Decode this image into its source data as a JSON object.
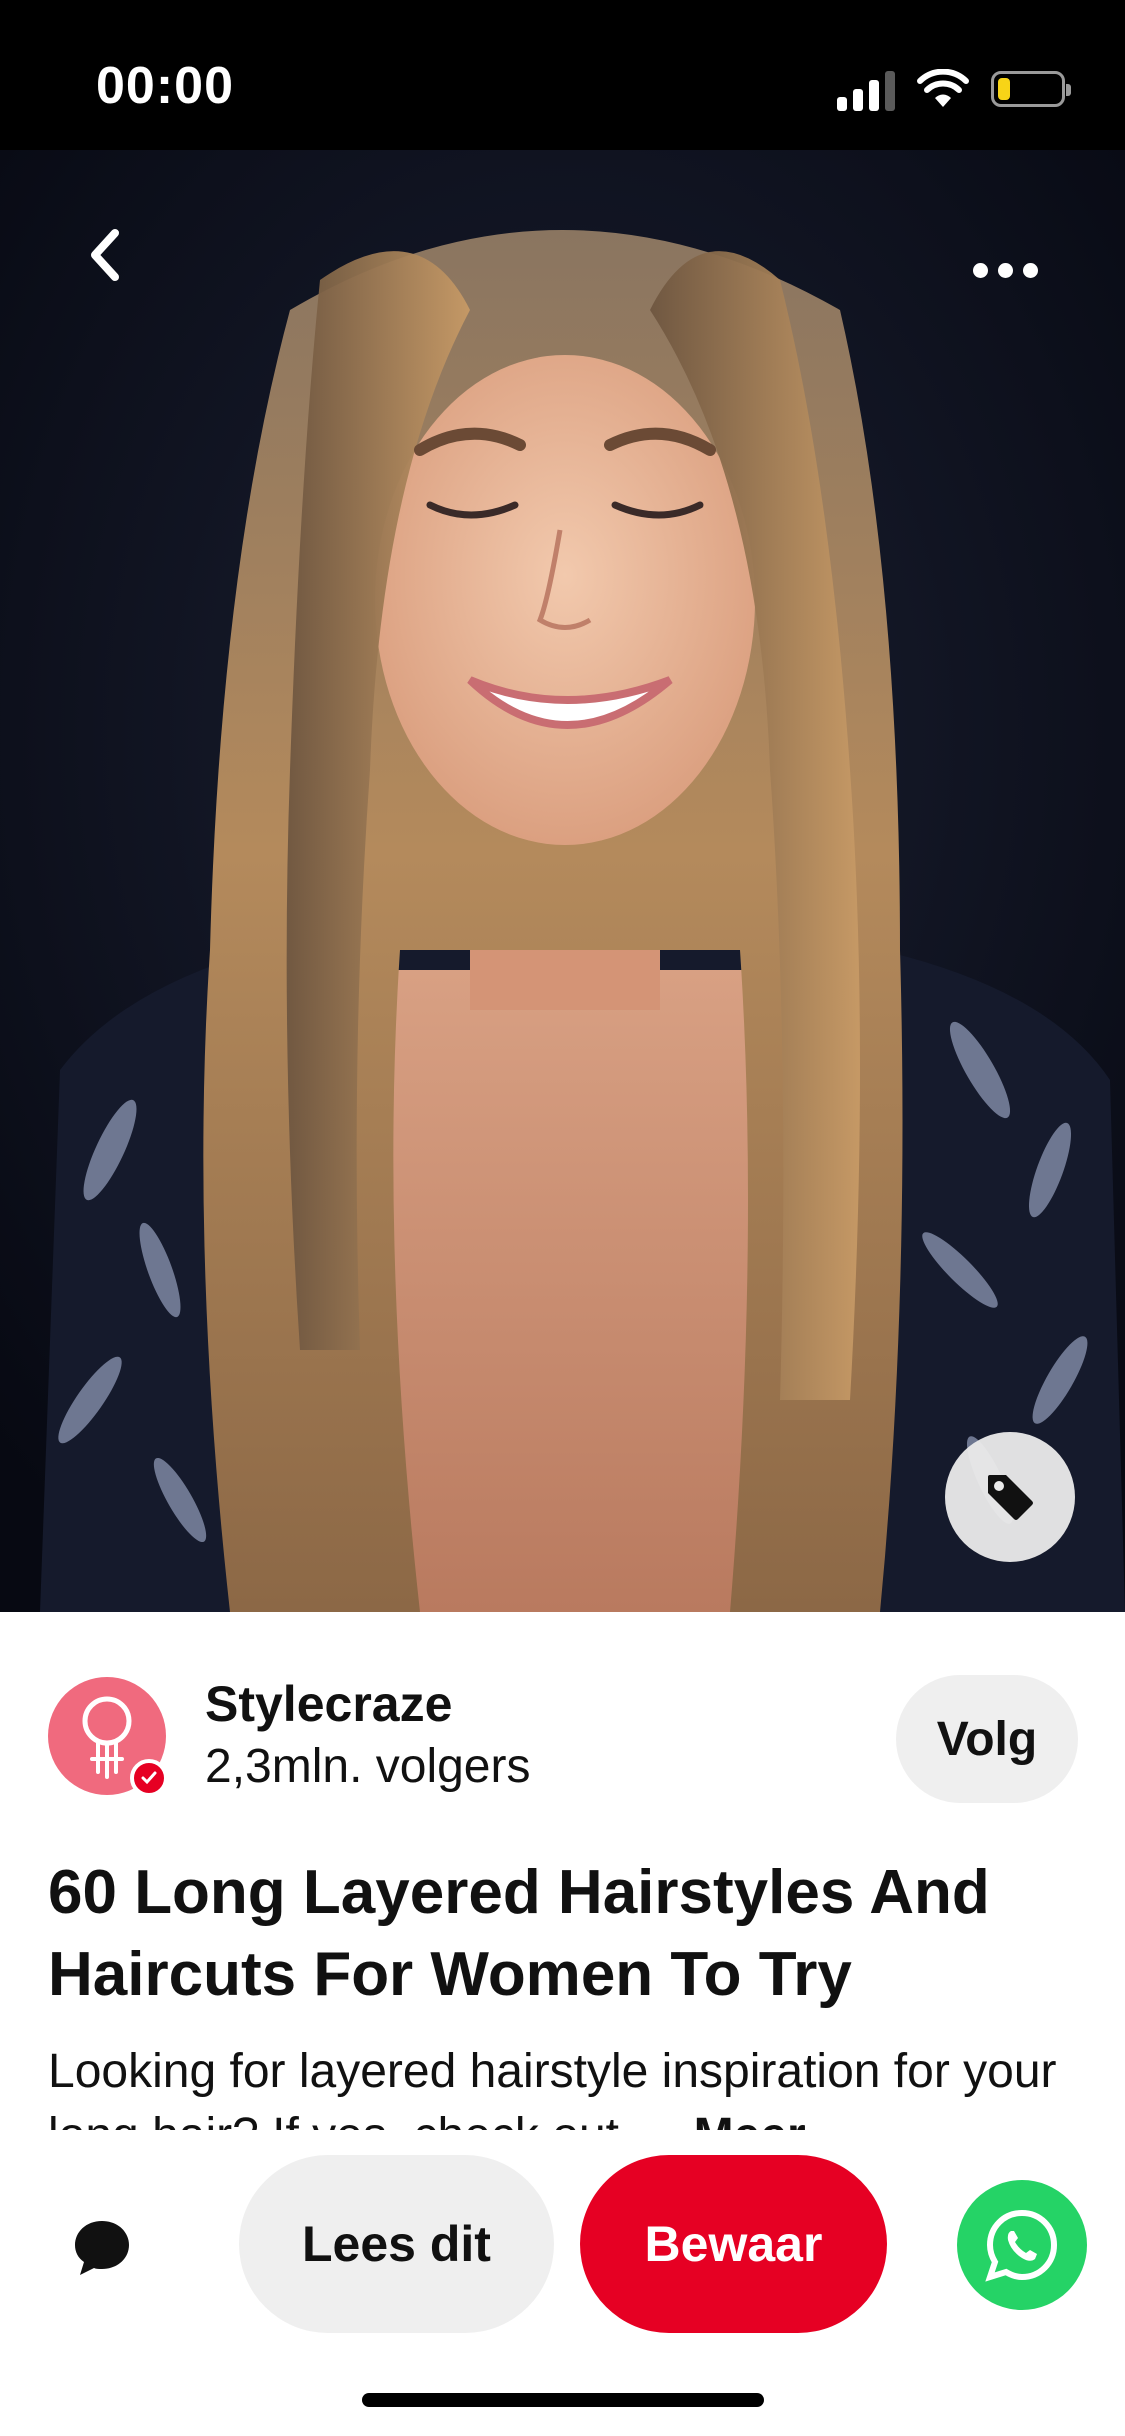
{
  "status_bar": {
    "time": "00:00",
    "battery_color": "#f7d417",
    "battery_level": 0.2
  },
  "pin": {
    "icons": {
      "back": "chevron-left-icon",
      "more": "more-horizontal-icon",
      "tag": "price-tag-icon"
    },
    "creator": {
      "name": "Stylecraze",
      "followers": "2,3mln. volgers",
      "follow_label": "Volg",
      "avatar_color": "#f06a7e",
      "verified_icon": "verified-check-icon"
    },
    "title": "60 Long Layered Hairstyles And Haircuts For Women To Try",
    "description": "Looking for layered hairstyle inspiration for your long hair? If yes, check out",
    "description_more": "Meer"
  },
  "actions": {
    "comment_icon": "comment-bubble-icon",
    "read_label": "Lees dit",
    "save_label": "Bewaar",
    "share_icon": "whatsapp-icon",
    "save_color": "#e60023",
    "whatsapp_color": "#25d366"
  }
}
